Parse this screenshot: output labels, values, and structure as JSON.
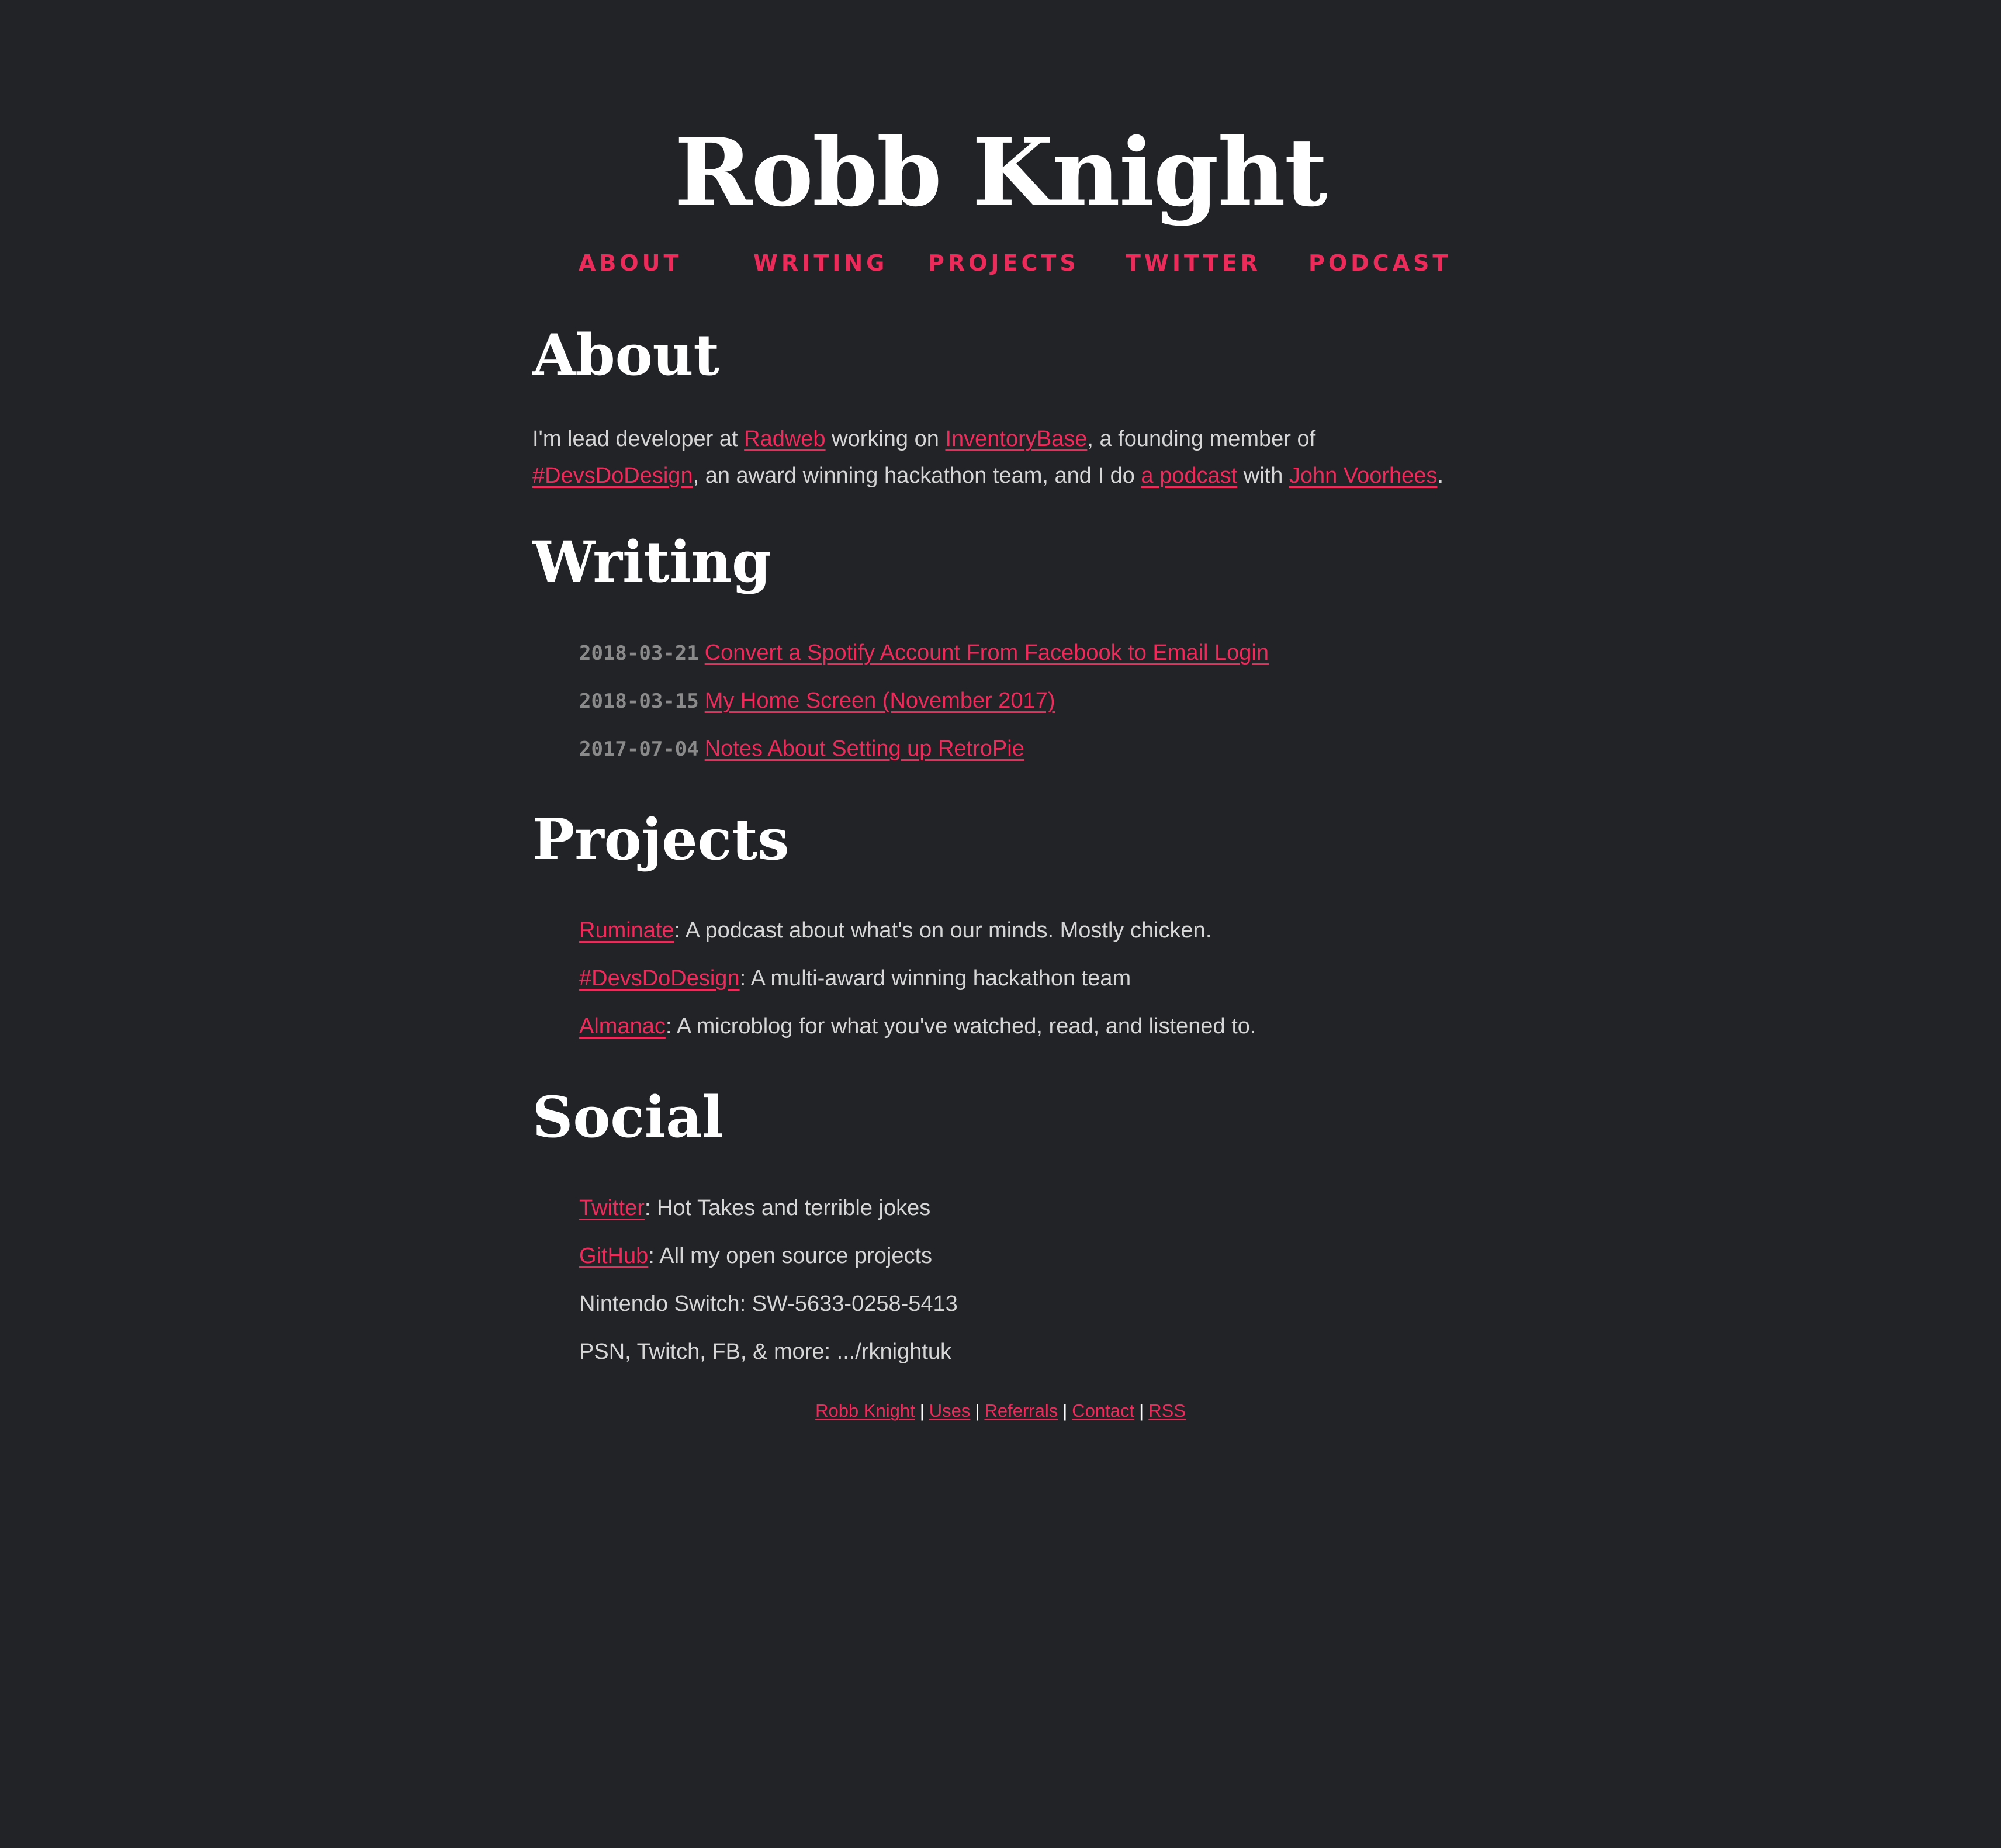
{
  "site": {
    "title": "Robb Knight"
  },
  "nav": {
    "items": [
      "ABOUT",
      "WRITING",
      "PROJECTS",
      "TWITTER",
      "PODCAST"
    ]
  },
  "about": {
    "heading": "About",
    "t1": "I'm lead developer at ",
    "radweb": "Radweb",
    "t2": " working on ",
    "inventorybase": "InventoryBase",
    "t3": ", a founding member of ",
    "devsdodesign": "#DevsDoDesign",
    "t4": ", an award winning hackathon team, and I do ",
    "podcast": "a podcast",
    "t5": " with ",
    "john": "John Voorhees",
    "t6": "."
  },
  "writing": {
    "heading": "Writing",
    "posts": [
      {
        "date": "2018-03-21",
        "title": "Convert a Spotify Account From Facebook to Email Login"
      },
      {
        "date": "2018-03-15",
        "title": "My Home Screen (November 2017)"
      },
      {
        "date": "2017-07-04",
        "title": "Notes About Setting up RetroPie"
      }
    ]
  },
  "projects": {
    "heading": "Projects",
    "items": [
      {
        "name": "Ruminate",
        "desc": ": A podcast about what's on our minds. Mostly chicken."
      },
      {
        "name": "#DevsDoDesign",
        "desc": ": A multi-award winning hackathon team"
      },
      {
        "name": "Almanac",
        "desc": ": A microblog for what you've watched, read, and listened to."
      }
    ]
  },
  "social": {
    "heading": "Social",
    "items": [
      {
        "name": "Twitter",
        "desc": ": Hot Takes and terrible jokes"
      },
      {
        "name": "GitHub",
        "desc": ": All my open source projects"
      }
    ],
    "switch": "Nintendo Switch: SW-5633-0258-5413",
    "psn": "PSN, Twitch, FB, & more: .../rknightuk"
  },
  "footer": {
    "links": [
      "Robb Knight",
      "Uses",
      "Referrals",
      "Contact",
      "RSS"
    ],
    "separator": "|"
  },
  "colors": {
    "background": "#222327",
    "accent": "#ec2b5b",
    "heading": "#ffffff",
    "text": "#d6d6d6",
    "date": "#8a8a8a"
  }
}
